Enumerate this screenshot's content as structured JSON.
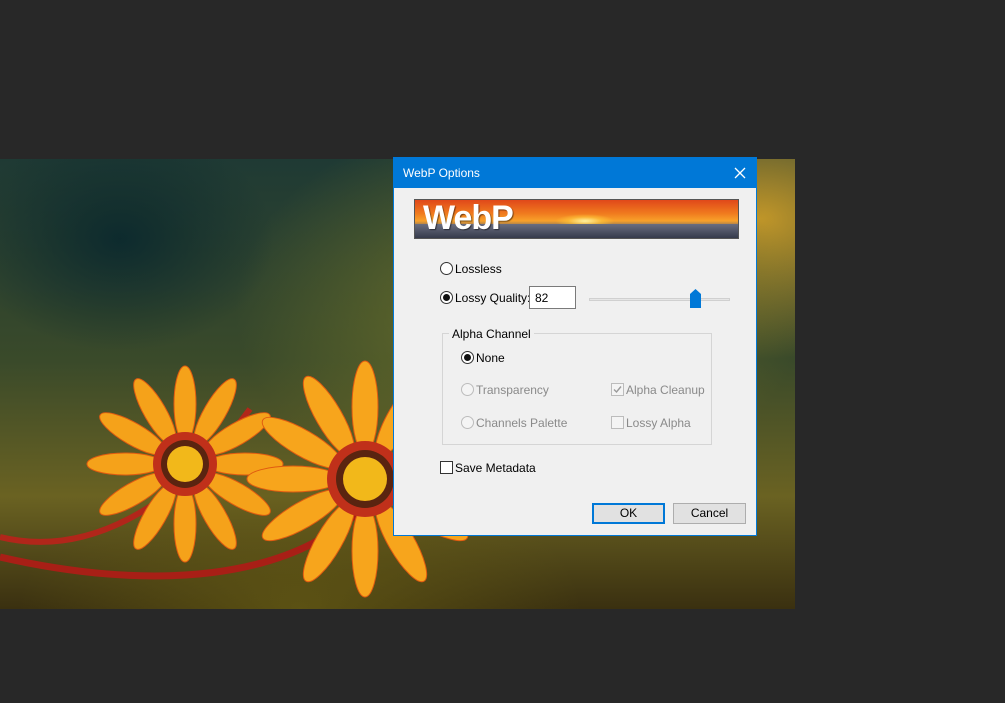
{
  "dialog": {
    "title": "WebP Options",
    "banner_text": "WebP",
    "compression": {
      "lossless_label": "Lossless",
      "lossy_label": "Lossy Quality:",
      "selected": "lossy",
      "quality_value": "82",
      "quality_slider_fraction": 0.78
    },
    "alpha_channel": {
      "legend": "Alpha Channel",
      "none_label": "None",
      "transparency_label": "Transparency",
      "channels_palette_label": "Channels Palette",
      "alpha_cleanup_label": "Alpha Cleanup",
      "lossy_alpha_label": "Lossy Alpha",
      "selected": "none",
      "alpha_cleanup_checked": true,
      "lossy_alpha_checked": false
    },
    "save_metadata_label": "Save Metadata",
    "save_metadata_checked": false,
    "ok_label": "OK",
    "cancel_label": "Cancel"
  },
  "colors": {
    "accent": "#0078d7",
    "workspace_bg": "#282828",
    "dialog_bg": "#f0f0f0"
  },
  "icons": {
    "close": "close-icon",
    "checkmark": "checkmark-icon",
    "slider_thumb": "slider-thumb-icon"
  }
}
